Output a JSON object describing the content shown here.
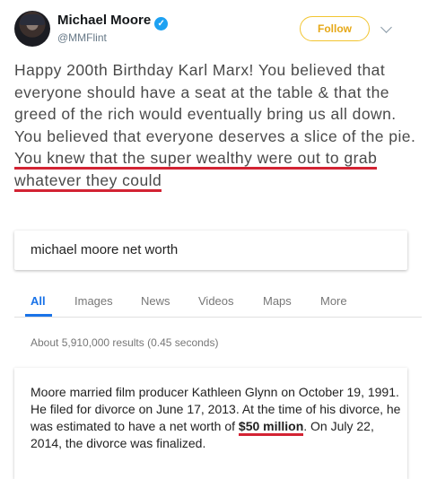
{
  "tweet": {
    "author_name": "Michael Moore",
    "handle": "@MMFlint",
    "follow_label": "Follow",
    "text_part1": "Happy 200th Birthday Karl Marx! You believed that everyone should have a seat at the table & that the greed of the rich would eventually bring us all down. You believed that everyone deserves a slice of the pie. ",
    "text_highlight": "You knew that the super wealthy were out to grab whatever they could"
  },
  "search": {
    "query": "michael moore net worth",
    "tabs": [
      "All",
      "Images",
      "News",
      "Videos",
      "Maps",
      "More"
    ],
    "active_tab": "All",
    "result_stats": "About 5,910,000 results (0.45 seconds)",
    "snippet_part1": "Moore married film producer Kathleen Glynn on October 19, 1991. He filed for divorce on June 17, 2013. At the time of his divorce, he was estimated to have a net worth of ",
    "snippet_highlight": "$50 million",
    "snippet_part2": ". On July 22, 2014, the divorce was finalized."
  },
  "colors": {
    "highlight_underline": "#d32333",
    "google_blue": "#1a73e8",
    "follow_yellow": "#f2c531",
    "verified_blue": "#1da1f2"
  }
}
